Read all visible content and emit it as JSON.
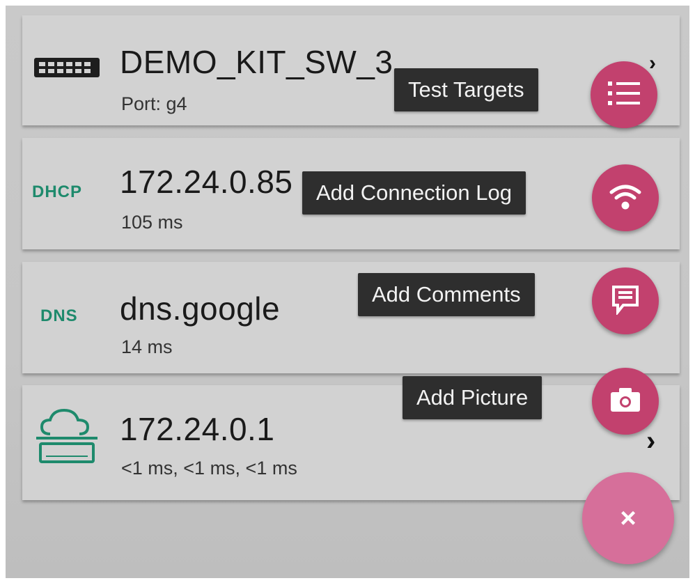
{
  "results": [
    {
      "title": "DEMO_KIT_SW_3",
      "subtitle": "Port:  g4",
      "icon": "switch-icon"
    },
    {
      "tag": "DHCP",
      "title": "172.24.0.85",
      "subtitle": "105 ms"
    },
    {
      "tag": "DNS",
      "title": "dns.google",
      "subtitle": "14 ms"
    },
    {
      "title": "172.24.0.1",
      "subtitle": "<1 ms, <1 ms, <1 ms",
      "icon": "cloud-gateway-icon"
    }
  ],
  "speed_dial": {
    "items": [
      {
        "label": "Test Targets",
        "icon": "list-icon"
      },
      {
        "label": "Add Connection Log",
        "icon": "wifi-icon"
      },
      {
        "label": "Add Comments",
        "icon": "comment-icon"
      },
      {
        "label": "Add Picture",
        "icon": "camera-icon"
      }
    ],
    "close_icon": "×"
  },
  "colors": {
    "accent": "#c2416e",
    "tag_green": "#1e8a6c",
    "tooltip_bg": "#2e2e2e",
    "card_bg": "#d2d2d2"
  }
}
